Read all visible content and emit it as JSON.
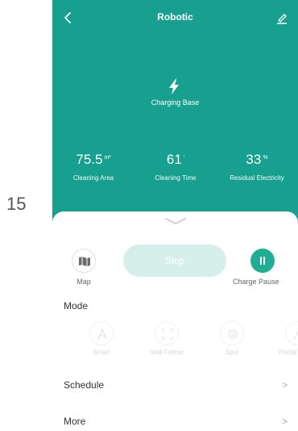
{
  "side_number": "15",
  "header": {
    "title": "Robotic",
    "back_icon": "back-chevron-icon",
    "edit_icon": "edit-pencil-icon"
  },
  "status": {
    "icon": "lightning-bolt-icon",
    "label": "Charging Base"
  },
  "stats": [
    {
      "value": "75.5",
      "unit": "m²",
      "label": "Cleaning Area"
    },
    {
      "value": "61",
      "unit": "'",
      "label": "Cleaning Time"
    },
    {
      "value": "33",
      "unit": "%",
      "label": "Residual Electricity"
    }
  ],
  "controls": {
    "map_label": "Map",
    "stop_label": "Stop",
    "pause_label": "Charge Pause"
  },
  "mode": {
    "title": "Mode",
    "items": [
      {
        "label": "Smart",
        "icon": "letter-a-icon"
      },
      {
        "label": "Wall Follow",
        "icon": "wall-follow-icon"
      },
      {
        "label": "Spot",
        "icon": "spot-icon"
      },
      {
        "label": "Partial Room",
        "icon": "partial-icon"
      }
    ]
  },
  "menu": [
    {
      "label": "Schedule",
      "chevron": ">"
    },
    {
      "label": "More",
      "chevron": ">"
    }
  ],
  "colors": {
    "accent": "#17a08f",
    "pause": "#1fae93",
    "stop_disabled": "#d6efea"
  }
}
